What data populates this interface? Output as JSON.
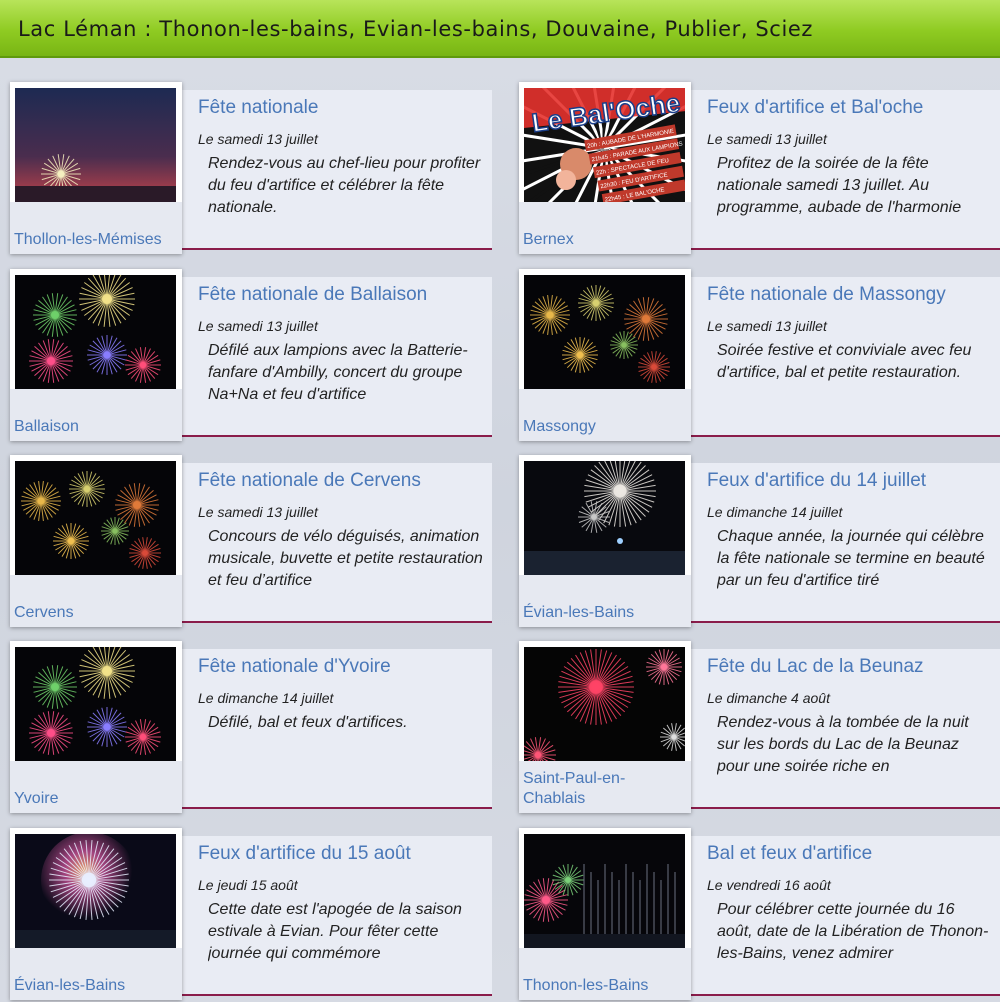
{
  "header": {
    "title": "Lac Léman : Thonon-les-bains, Evian-les-bains, Douvaine, Publier, Sciez"
  },
  "events": [
    {
      "place": "Thollon-les-Mémises",
      "title": "Fête nationale",
      "date": "Le samedi 13 juillet",
      "description": "Rendez-vous au chef-lieu pour profiter du feu d'artifice et célébrer la fête nationale.",
      "image": "firework-sunset"
    },
    {
      "place": "Bernex",
      "title": "Feux d'artifice et Bal'oche",
      "date": "Le samedi 13 juillet",
      "description": "Profitez de la soirée de la fête nationale samedi 13 juillet. Au programme, aubade de l'harmonie",
      "image": "poster-baloche",
      "poster": {
        "headline": "Le Bal'Oche",
        "lines": [
          "20h : AUBADE DE L'HARMONIE",
          "21h45 : PARADE AUX LAMPIONS",
          "22h : SPECTACLE DE FEU",
          "22h30 : FEU D'ARTIFICE",
          "22h45 : LE BAL'OCHE"
        ]
      }
    },
    {
      "place": "Ballaison",
      "title": "Fête nationale de Ballaison",
      "date": "Le samedi 13 juillet",
      "description": "Défilé aux lampions avec la Batterie-fanfare d'Ambilly, concert du groupe Na+Na et feu d'artifice",
      "image": "fireworks-colorful"
    },
    {
      "place": "Massongy",
      "title": "Fête nationale de Massongy",
      "date": "Le samedi 13 juillet",
      "description": "Soirée festive et conviviale avec feu d'artifice, bal et petite restauration.",
      "image": "fireworks-gold"
    },
    {
      "place": "Cervens",
      "title": "Fête nationale de Cervens",
      "date": "Le samedi 13 juillet",
      "description": "Concours de vélo déguisés, animation musicale, buvette et petite restauration et feu d’artifice",
      "image": "fireworks-gold"
    },
    {
      "place": "Évian-les-Bains",
      "title": "Feux d'artifice du 14 juillet",
      "date": "Le dimanche 14 juillet",
      "description": "Chaque année, la journée qui célèbre la fête nationale se termine en beauté par un feu d'artifice tiré",
      "image": "fireworks-white-lake"
    },
    {
      "place": "Yvoire",
      "title": "Fête nationale d'Yvoire",
      "date": "Le dimanche 14 juillet",
      "description": "Défilé, bal et feux d'artifices.",
      "image": "fireworks-colorful"
    },
    {
      "place": "Saint-Paul-en-Chablais",
      "title": "Fête du Lac de la Beunaz",
      "date": "Le dimanche 4 août",
      "description": "Rendez-vous à la tombée de la nuit sur les bords du Lac de la Beunaz pour une soirée riche en",
      "image": "fireworks-red"
    },
    {
      "place": "Évian-les-Bains",
      "title": "Feux d'artifice du 15 août",
      "date": "Le jeudi 15 août",
      "description": "Cette date est l'apogée de la saison estivale à Evian. Pour fêter cette journée qui commémore",
      "image": "fireworks-glow-lake"
    },
    {
      "place": "Thonon-les-Bains",
      "title": "Bal et feux d'artifice",
      "date": "Le vendredi 16 août",
      "description": "Pour célébrer cette journée du 16 août, date de la Libération de Thonon-les-Bains, venez admirer",
      "image": "fireworks-harbor"
    }
  ]
}
